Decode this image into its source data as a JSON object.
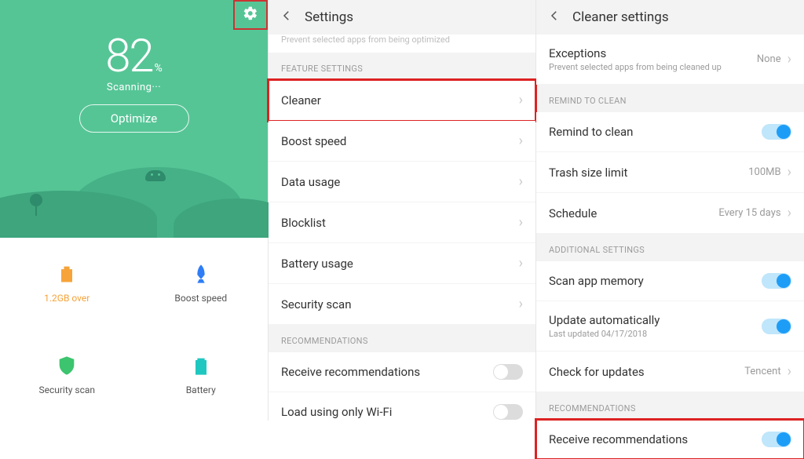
{
  "panel1": {
    "score": "82",
    "pct": "%",
    "status": "Scanning···",
    "optimize": "Optimize",
    "tiles": [
      {
        "label": "1.2GB over"
      },
      {
        "label": "Boost speed"
      },
      {
        "label": "Security scan"
      },
      {
        "label": "Battery"
      }
    ]
  },
  "panel2": {
    "title": "Settings",
    "truncated": "Prevent selected apps from being optimized",
    "section_feature": "FEATURE SETTINGS",
    "items": [
      {
        "label": "Cleaner"
      },
      {
        "label": "Boost speed"
      },
      {
        "label": "Data usage"
      },
      {
        "label": "Blocklist"
      },
      {
        "label": "Battery usage"
      },
      {
        "label": "Security scan"
      }
    ],
    "section_rec": "RECOMMENDATIONS",
    "rec_items": [
      {
        "label": "Receive recommendations"
      },
      {
        "label": "Load using only Wi-Fi"
      }
    ]
  },
  "panel3": {
    "title": "Cleaner settings",
    "exceptions": {
      "label": "Exceptions",
      "sub": "Prevent selected apps from being cleaned up",
      "value": "None"
    },
    "section_remind": "REMIND TO CLEAN",
    "remind": {
      "label": "Remind to clean"
    },
    "trash": {
      "label": "Trash size limit",
      "value": "100MB"
    },
    "schedule": {
      "label": "Schedule",
      "value": "Every 15 days"
    },
    "section_additional": "ADDITIONAL SETTINGS",
    "scanmem": {
      "label": "Scan app memory"
    },
    "update": {
      "label": "Update automatically",
      "sub": "Last updated 04/17/2018"
    },
    "checkupd": {
      "label": "Check for updates",
      "value": "Tencent"
    },
    "section_rec": "RECOMMENDATIONS",
    "recv": {
      "label": "Receive recommendations"
    }
  }
}
